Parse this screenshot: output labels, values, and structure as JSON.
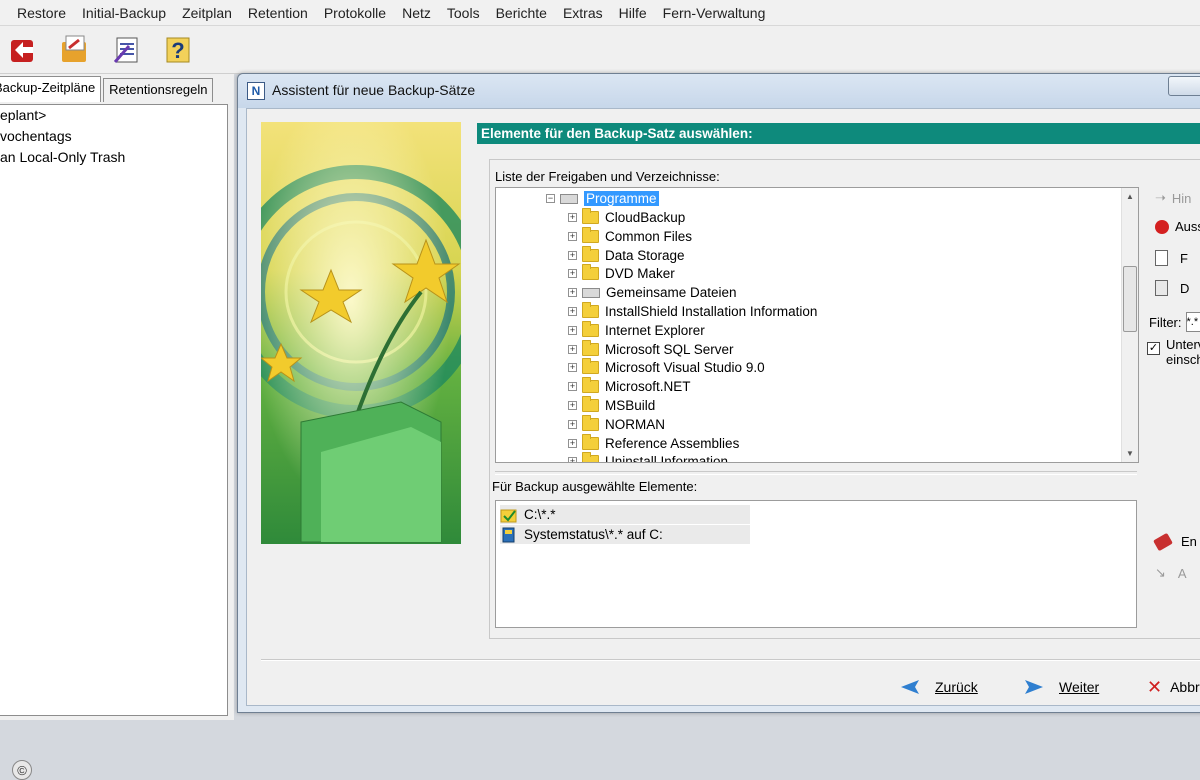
{
  "menu": [
    "Restore",
    "Initial-Backup",
    "Zeitplan",
    "Retention",
    "Protokolle",
    "Netz",
    "Tools",
    "Berichte",
    "Extras",
    "Hilfe",
    "Fern-Verwaltung"
  ],
  "toolbar_icons": [
    "restore-icon",
    "backup-icon",
    "wizard-icon",
    "help-icon"
  ],
  "left": {
    "tabs": [
      "Backup-Zeitpläne",
      "Retentionsregeln"
    ],
    "items": [
      "eplant>",
      "vochentags",
      "an Local-Only Trash"
    ]
  },
  "dialog": {
    "title": "Assistent für neue Backup-Sätze",
    "heading": "Elemente für den Backup-Satz auswählen:",
    "list_label": "Liste der Freigaben und Verzeichnisse:",
    "root": "Programme",
    "folders": [
      "CloudBackup",
      "Common Files",
      "Data Storage",
      "DVD Maker",
      "Gemeinsame Dateien",
      "InstallShield Installation Information",
      "Internet Explorer",
      "Microsoft SQL Server",
      "Microsoft Visual Studio 9.0",
      "Microsoft.NET",
      "MSBuild",
      "NORMAN",
      "Reference Assemblies",
      "Uninstall Information"
    ],
    "selected_label": "Für Backup ausgewählte Elemente:",
    "selected_items": [
      "C:\\*.*",
      "Systemstatus\\*.* auf C:"
    ],
    "right_actions": [
      "Hin",
      "Auss",
      "F",
      "D"
    ],
    "filter_label": "Filter:",
    "filter_value": "*.*",
    "subdir_label_1": "Unterv",
    "subdir_label_2": "einsch",
    "remove_actions": [
      "En",
      "A"
    ],
    "back": "Zurück",
    "next": "Weiter",
    "cancel": "Abbr"
  }
}
